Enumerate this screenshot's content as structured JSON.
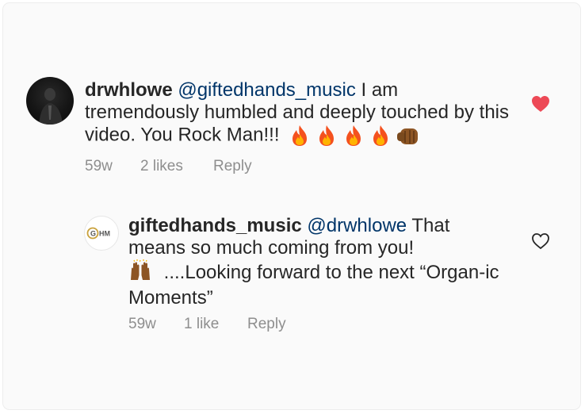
{
  "colors": {
    "text": "#262626",
    "mention": "#003569",
    "meta": "#8e8e8e",
    "heart_filled": "#ed4956",
    "background": "#fafafa"
  },
  "comments": [
    {
      "username": "drwhlowe",
      "mention": "@giftedhands_music",
      "text": " I am tremendously humbled and deeply touched by this video. You Rock Man!!!",
      "emojis": [
        "fire-emoji",
        "fire-emoji",
        "fire-emoji",
        "fire-emoji",
        "fist-bump-emoji"
      ],
      "time": "59w",
      "likes": "2 likes",
      "reply_label": "Reply",
      "liked": true
    },
    {
      "username": "giftedhands_music",
      "mention": "@drwhlowe",
      "text_line1": " That means so much coming from you!",
      "emoji": "raising-hands-emoji",
      "text_line2": " ....Looking forward to the next “Organ-ic Moments”",
      "avatar_logo": "GHM",
      "time": "59w",
      "likes": "1 like",
      "reply_label": "Reply",
      "liked": false
    }
  ]
}
